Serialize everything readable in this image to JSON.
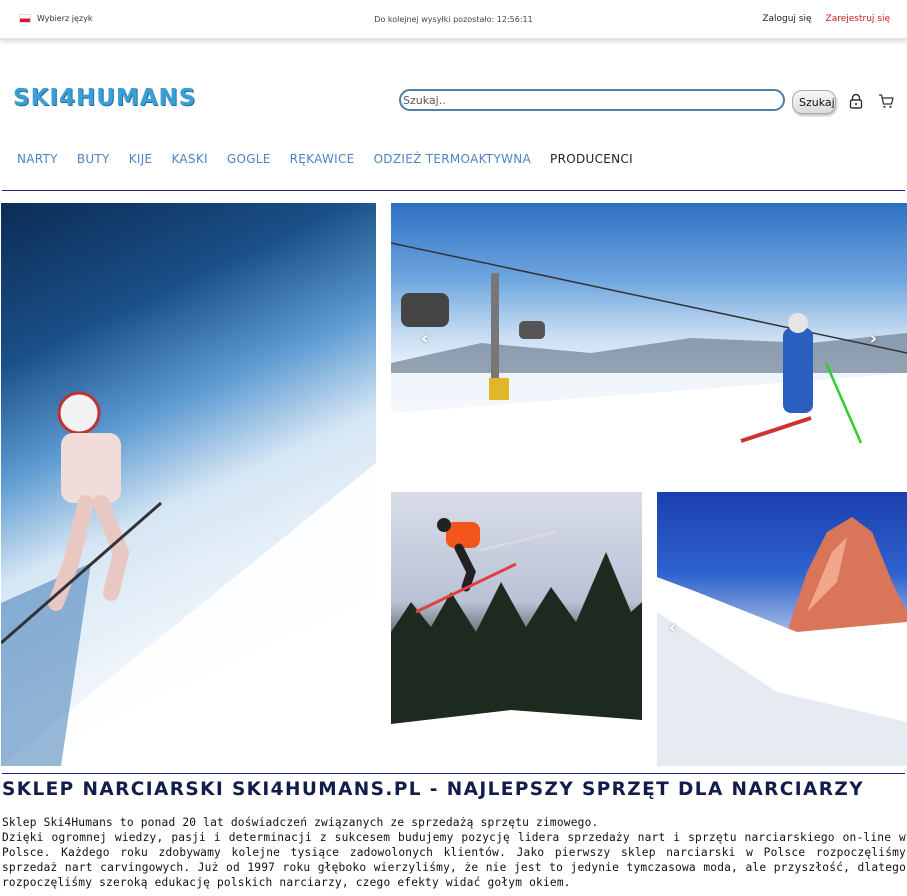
{
  "topbar": {
    "language_label": "Wybierz język",
    "shipping_text": "Do kolejnej wysyłki pozostało: 12:56:11",
    "login_label": "Zaloguj się",
    "register_label": "Zarejestruj się"
  },
  "header": {
    "logo_text": "SKI4HUMANS",
    "search_placeholder": "Szukaj..",
    "search_button_label": "Szukaj",
    "icons": [
      "lock-icon",
      "cart-icon"
    ]
  },
  "nav": {
    "items": [
      {
        "label": "NARTY"
      },
      {
        "label": "BUTY"
      },
      {
        "label": "KIJE"
      },
      {
        "label": "KASKI"
      },
      {
        "label": "GOGLE"
      },
      {
        "label": "RĘKAWICE"
      },
      {
        "label": "ODZIEŻ TERMOAKTYWNA"
      },
      {
        "label": "PRODUCENCI"
      }
    ]
  },
  "gallery": {
    "arrow_prev": "‹",
    "arrow_next": "›"
  },
  "content": {
    "heading": "SKLEP NARCIARSKI SKI4HUMANS.PL - NAJLEPSZY SPRZĘT DLA NARCIARZY",
    "line1": "Sklep Ski4Humans to ponad 20 lat doświadczeń związanych ze sprzedażą sprzętu zimowego.",
    "line2": "Dzięki ogromnej wiedzy, pasji i determinacji z sukcesem budujemy pozycję lidera sprzedaży nart i sprzętu narciarskiego on-line w Polsce. Każdego roku zdobywamy kolejne tysiące zadowolonych klientów. Jako pierwszy sklep narciarski w Polsce rozpoczęliśmy sprzedaż nart carvingowych. Już od 1997 roku głęboko wierzyliśmy, że nie jest to jedynie tymczasowa moda, ale przyszłość, dlatego rozpoczęliśmy szeroką edukację polskich narciarzy, czego efekty widać gołym okiem."
  },
  "colors": {
    "accent_blue": "#4e83c2",
    "logo_blue": "#3e9fd6",
    "register_red": "#cc1b1b",
    "divider_navy": "#21227a"
  }
}
